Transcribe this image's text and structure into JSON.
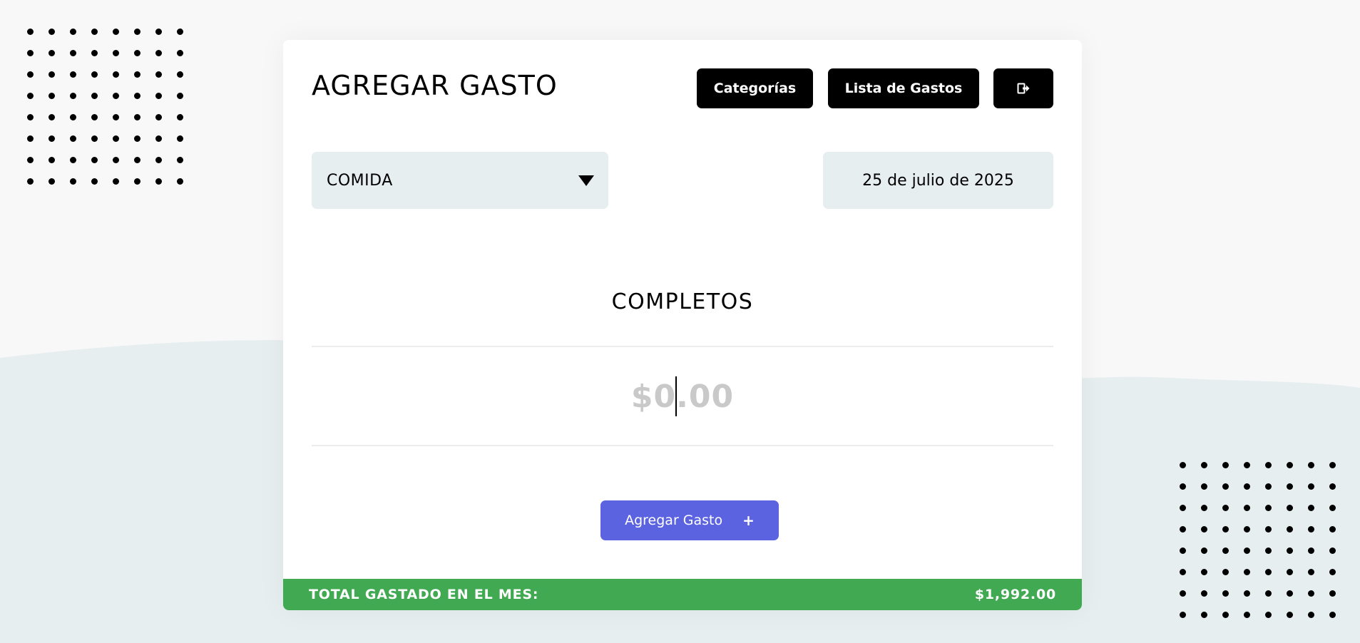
{
  "page": {
    "title": "AGREGAR GASTO"
  },
  "header": {
    "categories_label": "Categorías",
    "list_label": "Lista de Gastos",
    "logout_icon": "logout-icon"
  },
  "form": {
    "category": {
      "selected": "COMIDA",
      "icon": "caret-down-icon"
    },
    "date": "25 de julio de 2025",
    "description": "COMPLETOS",
    "amount": {
      "prefix": "$0",
      "suffix": ".00"
    },
    "submit_label": "Agregar Gasto",
    "submit_icon": "+"
  },
  "total": {
    "label": "TOTAL GASTADO EN EL MES:",
    "value": "$1,992.00"
  },
  "colors": {
    "primary_button": "#5b63e1",
    "total_bar": "#42a953",
    "field_bg": "#e7eef0",
    "dark_button": "#000000"
  }
}
